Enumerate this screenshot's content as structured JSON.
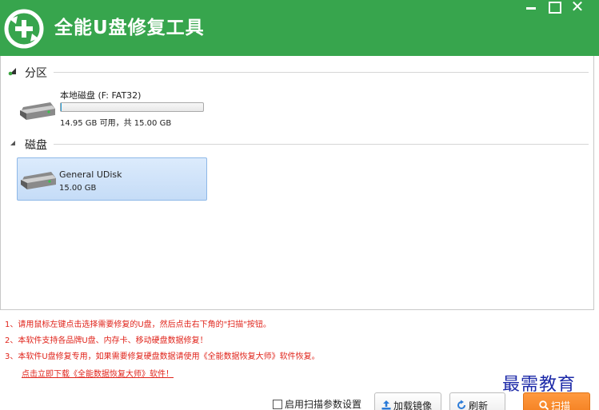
{
  "titlebar": {
    "title": "全能U盘修复工具",
    "min_icon": "minimize-icon",
    "max_icon": "maximize-icon",
    "close_icon": "close-icon",
    "close_glyph": "✕",
    "bg_color": "#37a54d"
  },
  "partitions_group": {
    "title": "分区",
    "items": [
      {
        "name": "本地磁盘 (F: FAT32)",
        "usage_fraction": 0.003,
        "capacity": "14.95 GB 可用，共 15.00 GB"
      }
    ]
  },
  "disks_group": {
    "title": "磁盘",
    "items": [
      {
        "name": "General UDisk",
        "size": "15.00 GB",
        "selected": true
      }
    ]
  },
  "tips": [
    "1、请用鼠标左键点击选择需要修复的U盘，然后点击右下角的\"扫描\"按钮。",
    "2、本软件支持各品牌U盘、内存卡、移动硬盘数据修复！",
    "3、本软件U盘修复专用，如果需要修复硬盘数据请使用《全能数据恢复大师》软件恢复。"
  ],
  "download_link": "点击立即下载《全能数据恢复大师》软件！",
  "controls": {
    "scan_params_label": "启用扫描参数设置",
    "scan_params_checked": false,
    "load_image_label": "加载镜像",
    "refresh_label": "刷新",
    "scan_label": "扫描"
  },
  "watermark": "最需教育",
  "colors": {
    "accent_green": "#37a54d",
    "tip_red": "#e0241b",
    "scan_orange": "#f27d1e",
    "selection_blue": "#c5dcf7"
  }
}
